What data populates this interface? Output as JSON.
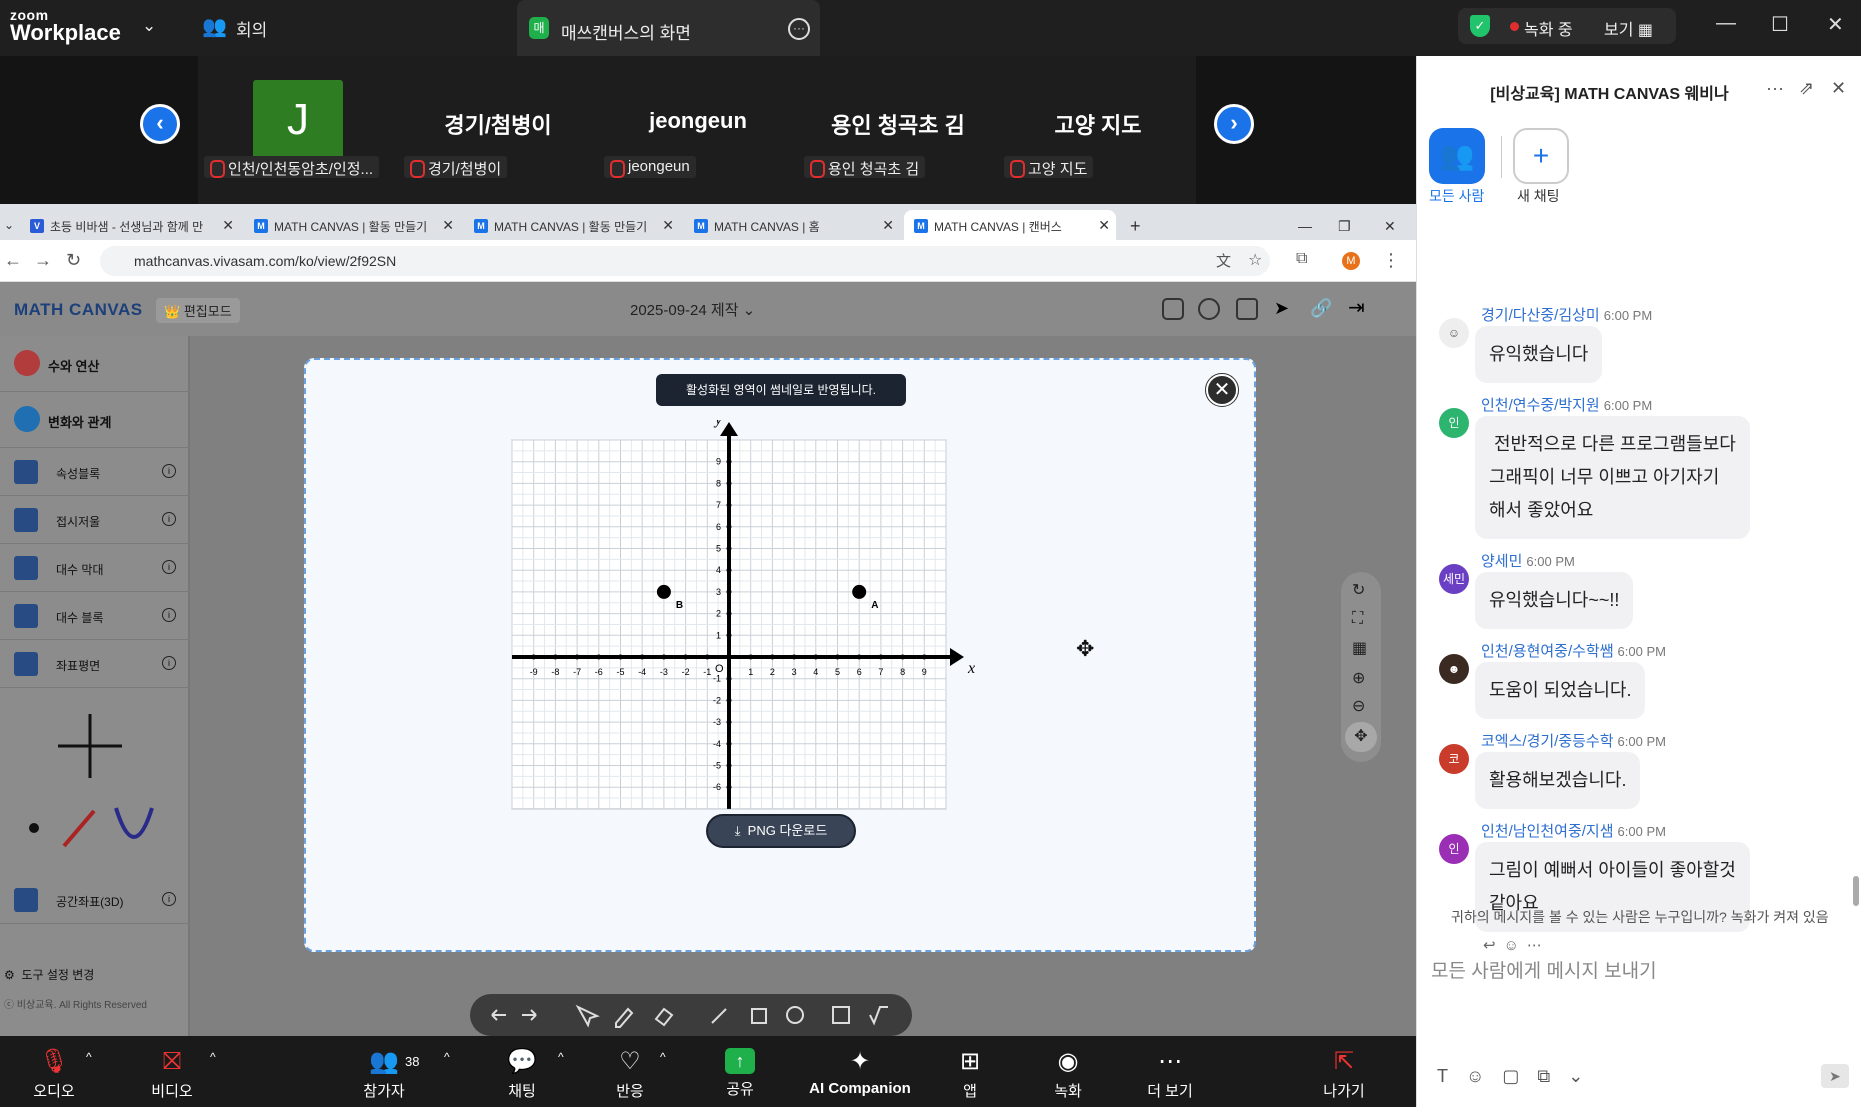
{
  "zoom": {
    "brand_top": "zoom",
    "brand_bottom": "Workplace",
    "meeting_label": "회의",
    "share_badge": "매",
    "share_label": "매쓰캔버스의 화면",
    "recording_label": "녹화 중",
    "view_label": "보기"
  },
  "participants": [
    {
      "big": "J",
      "tag": "인천/인천동암초/인정..."
    },
    {
      "big": "경기/첨병이",
      "tag": "경기/첨병이"
    },
    {
      "big": "jeongeun",
      "tag": "jeongeun"
    },
    {
      "big": "용인 청곡초 김",
      "tag": "용인 청곡초 김"
    },
    {
      "big": "고양 지도",
      "tag": "고양 지도"
    }
  ],
  "browser": {
    "tabs": [
      {
        "fav": "V",
        "title": "초등 비바샘 - 선생님과 함께 만"
      },
      {
        "fav": "M",
        "title": "MATH CANVAS | 활동 만들기"
      },
      {
        "fav": "M",
        "title": "MATH CANVAS | 활동 만들기"
      },
      {
        "fav": "M",
        "title": "MATH CANVAS | 홈"
      },
      {
        "fav": "M",
        "title": "MATH CANVAS | 캔버스"
      }
    ],
    "url": "mathcanvas.vivasam.com/ko/view/2f92SN",
    "profile_initial": "M"
  },
  "app": {
    "logo": "MATH CANVAS",
    "edit_mode": "편집모드",
    "date": "2025-09-24 제작",
    "categories": [
      "수와 연산",
      "변화와 관계"
    ],
    "items": [
      "속성블록",
      "접시저울",
      "대수 막대",
      "대수 블록",
      "좌표평면"
    ],
    "item_3d": "공간좌표(3D)",
    "tool_settings": "도구 설정 변경",
    "copyright": "ⓒ 비상교육. All Rights Reserved"
  },
  "modal": {
    "toast": "활성화된 영역이 썸네일로 반영됩니다.",
    "png_button": "PNG 다운로드"
  },
  "chart_data": {
    "type": "scatter",
    "xlabel": "x",
    "ylabel": "y",
    "xlim": [
      -9,
      9
    ],
    "ylim": [
      -6,
      9
    ],
    "origin_label": "O",
    "points": [
      {
        "label": "A",
        "x": 6,
        "y": 3
      },
      {
        "label": "B",
        "x": -3,
        "y": 3
      }
    ],
    "grid": true
  },
  "bottombar": [
    {
      "label": "오디오",
      "icon": "mic-muted-icon"
    },
    {
      "label": "비디오",
      "icon": "video-off-icon"
    },
    {
      "label": "참가자",
      "count": "38",
      "icon": "participants-icon"
    },
    {
      "label": "채팅",
      "icon": "chat-icon"
    },
    {
      "label": "반응",
      "icon": "heart-icon"
    },
    {
      "label": "공유",
      "icon": "share-icon"
    },
    {
      "label": "AI Companion",
      "icon": "sparkle-icon"
    },
    {
      "label": "앱",
      "icon": "apps-icon"
    },
    {
      "label": "녹화",
      "icon": "record-icon"
    },
    {
      "label": "더 보기",
      "icon": "more-icon"
    },
    {
      "label": "나가기",
      "icon": "leave-icon"
    }
  ],
  "chat": {
    "title": "[비상교육] MATH CANVAS 웨비나",
    "tab_everyone": "모든 사람",
    "tab_new_chat": "새 채팅",
    "messages": [
      {
        "sender": "경기/다산중/김상미",
        "time": "6:00 PM",
        "avatar": "",
        "text": [
          "유익했습니다"
        ]
      },
      {
        "sender": "인천/연수중/박지원",
        "time": "6:00 PM",
        "avatar": "인",
        "text": [
          " 전반적으로 다른 프로그램들보다",
          "그래픽이 너무 이쁘고 아기자기",
          "해서 좋았어요"
        ]
      },
      {
        "sender": "양세민",
        "time": "6:00 PM",
        "avatar": "세민",
        "text": [
          "유익했습니다~~!!"
        ]
      },
      {
        "sender": "인천/용현여중/수학쌤",
        "time": "6:00 PM",
        "avatar": "",
        "text": [
          "도움이 되었습니다."
        ]
      },
      {
        "sender": "코엑스/경기/중등수학",
        "time": "6:00 PM",
        "avatar": "코",
        "text": [
          "활용해보겠습니다."
        ]
      },
      {
        "sender": "인천/남인천여중/지샘",
        "time": "6:00 PM",
        "avatar": "인",
        "text": [
          "그림이 예뻐서 아이들이 좋아할것",
          "같아요"
        ]
      }
    ],
    "notice": "귀하의 메시지를 볼 수 있는 사람은 누구입니까? 녹화가 켜져 있음",
    "input_placeholder": "모든 사람에게 메시지 보내기"
  }
}
